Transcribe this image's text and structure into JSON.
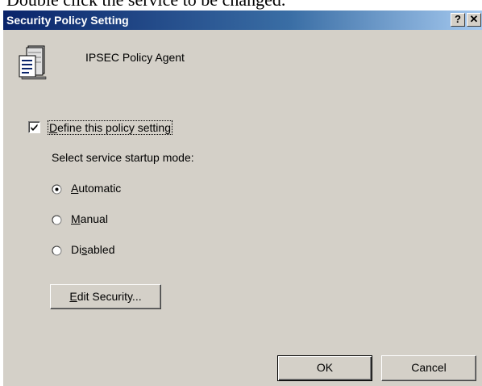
{
  "page": {
    "caption_fragment": "Double click the service to be changed."
  },
  "window": {
    "title": "Security Policy Setting",
    "help_button": "?",
    "close_button": "✕"
  },
  "service": {
    "icon": "service-document-icon",
    "name": "IPSEC Policy Agent"
  },
  "define_setting": {
    "checked": true,
    "label_accel": "D",
    "label_rest": "efine this policy setting"
  },
  "startup": {
    "prompt": "Select service startup mode:",
    "options": [
      {
        "accel": "A",
        "rest": "utomatic",
        "selected": true
      },
      {
        "accel": "M",
        "rest": "anual",
        "selected": false
      },
      {
        "pre": "Di",
        "accel": "s",
        "post": "abled",
        "selected": false
      }
    ]
  },
  "buttons": {
    "edit_security_accel": "E",
    "edit_security_rest": "dit Security...",
    "ok": "OK",
    "cancel": "Cancel"
  },
  "colors": {
    "dialog_bg": "#d4d0c8",
    "title_gradient_start": "#0a246a",
    "title_gradient_end": "#a6caf0"
  }
}
